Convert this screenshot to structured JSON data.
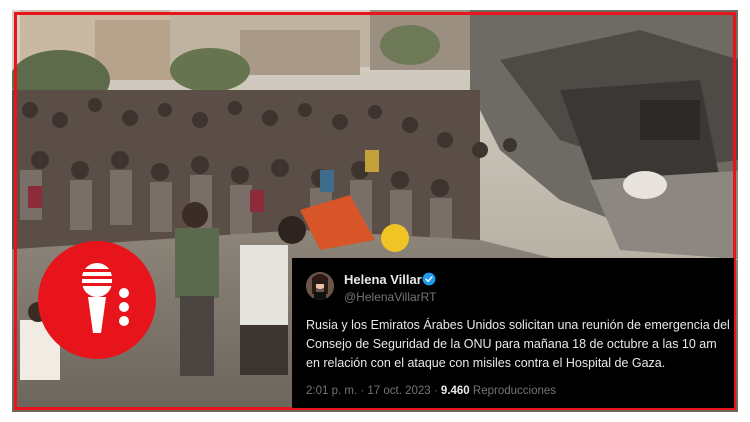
{
  "brand": {
    "accent": "#e8141c"
  },
  "tweet": {
    "author_name": "Helena Villar",
    "author_handle": "@HelenaVillarRT",
    "verified_icon": "verified-badge-icon",
    "text": "Rusia y los Emiratos Árabes Unidos solicitan una reunión de emergencia del Consejo de Seguridad de la ONU para mañana 18 de octubre a las 10 am en relación con el ataque con misiles contra el Hospital de Gaza.",
    "time": "2:01 p. m.",
    "separator": " · ",
    "date": "17 oct. 2023",
    "views_count": "9.460",
    "views_label": "Reproducciones"
  },
  "badge": {
    "icon": "microphone-icon",
    "dots_icon": "more-dots-icon"
  }
}
